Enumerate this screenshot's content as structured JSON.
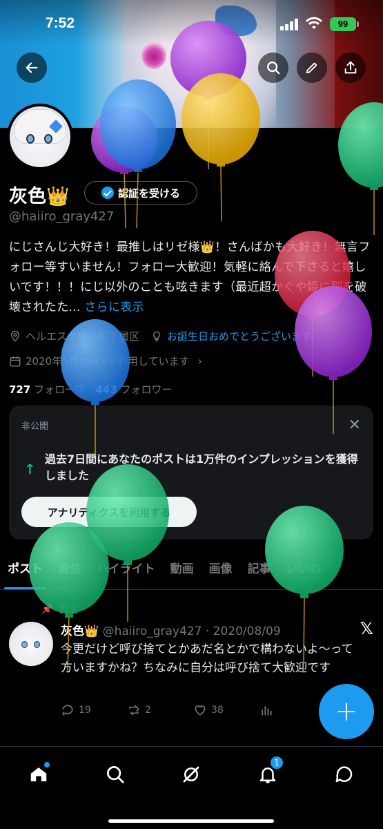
{
  "status_bar": {
    "time": "7:52",
    "battery": "99"
  },
  "top_buttons": {
    "back_icon": "arrow-left-icon",
    "search_icon": "search-icon",
    "edit_icon": "pencil-icon",
    "share_icon": "share-icon"
  },
  "profile": {
    "name": "灰色👑",
    "verify_label": "認証を受ける",
    "handle": "@haiiro_gray427",
    "bio": "にじさんじ大好き！最推しはリゼ様👑！さんばかも大好き！無言フォロー等すいません！フォロー大歓迎！気軽に絡んで下さると嬉しいです！！！にじ以外のことも呟きます（最近超かぐや姫に脳を破壊されたた...",
    "bio_more": "さらに表示",
    "location": "ヘルエスタ城下町下層区",
    "website": "お誕生日おめでとうございます。",
    "joined": "2020年5月からXを利用しています",
    "following_count": "727",
    "following_label": "フォロー中",
    "followers_count": "443",
    "followers_label": "フォロワー"
  },
  "private_card": {
    "label": "非公開",
    "message": "過去7日間にあなたのポストは1万件のインプレッションを獲得しました",
    "button": "アナリティクスを利用する"
  },
  "tabs": [
    "ポスト",
    "返信",
    "ハイライト",
    "動画",
    "画像",
    "記事",
    "いいね"
  ],
  "active_tab": "ポスト",
  "post": {
    "pinned_label": "固定",
    "author": "灰色👑",
    "handle_date": "@haiiro_gray427 · 2020/08/09",
    "text": "今更だけど呼び捨てとかあだ名とかで構わないよ〜って方いますかね？ちなみに自分は呼び捨て大歓迎です",
    "replies": "19",
    "reposts": "2",
    "likes": "38"
  },
  "fab_label": "+",
  "bottom_nav": {
    "items": [
      "home-icon",
      "search-icon",
      "grok-icon",
      "notifications-icon",
      "messages-icon"
    ],
    "notification_count": "1"
  },
  "colors": {
    "accent": "#1d9bf0",
    "background": "#000000",
    "card": "#16181c",
    "muted": "#71767b"
  }
}
